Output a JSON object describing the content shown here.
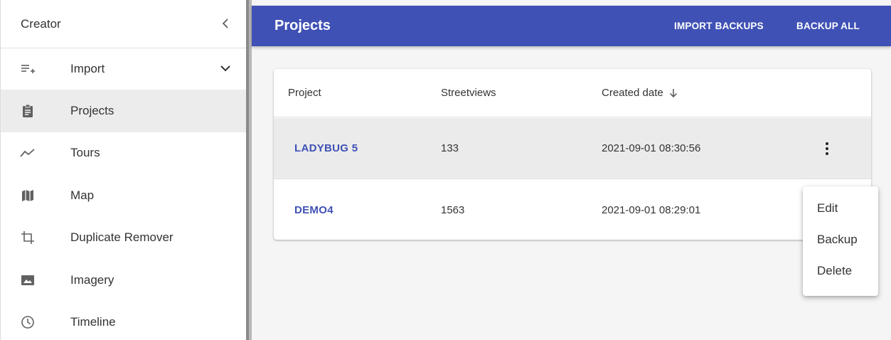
{
  "sidebar": {
    "title": "Creator",
    "collapse_icon": "chevron-left-icon",
    "items": [
      {
        "label": "Import",
        "icon": "playlist-add-icon",
        "expandable": true
      },
      {
        "label": "Projects",
        "icon": "clipboard-icon",
        "active": true
      },
      {
        "label": "Tours",
        "icon": "timeline-icon"
      },
      {
        "label": "Map",
        "icon": "map-icon"
      },
      {
        "label": "Duplicate Remover",
        "icon": "crop-icon"
      },
      {
        "label": "Imagery",
        "icon": "image-icon"
      },
      {
        "label": "Timeline",
        "icon": "clock-icon"
      }
    ]
  },
  "header": {
    "title": "Projects",
    "import_backups_label": "IMPORT BACKUPS",
    "backup_all_label": "BACKUP ALL",
    "color": "#3f51b5"
  },
  "table": {
    "columns": [
      "Project",
      "Streetviews",
      "Created date"
    ],
    "sort_icon": "arrow-down-icon",
    "rows": [
      {
        "project": "LADYBUG 5",
        "streetviews": "133",
        "created": "2021-09-01 08:30:56"
      },
      {
        "project": "DEMO4",
        "streetviews": "1563",
        "created": "2021-09-01 08:29:01"
      }
    ]
  },
  "context_menu": {
    "items": [
      "Edit",
      "Backup",
      "Delete"
    ]
  }
}
